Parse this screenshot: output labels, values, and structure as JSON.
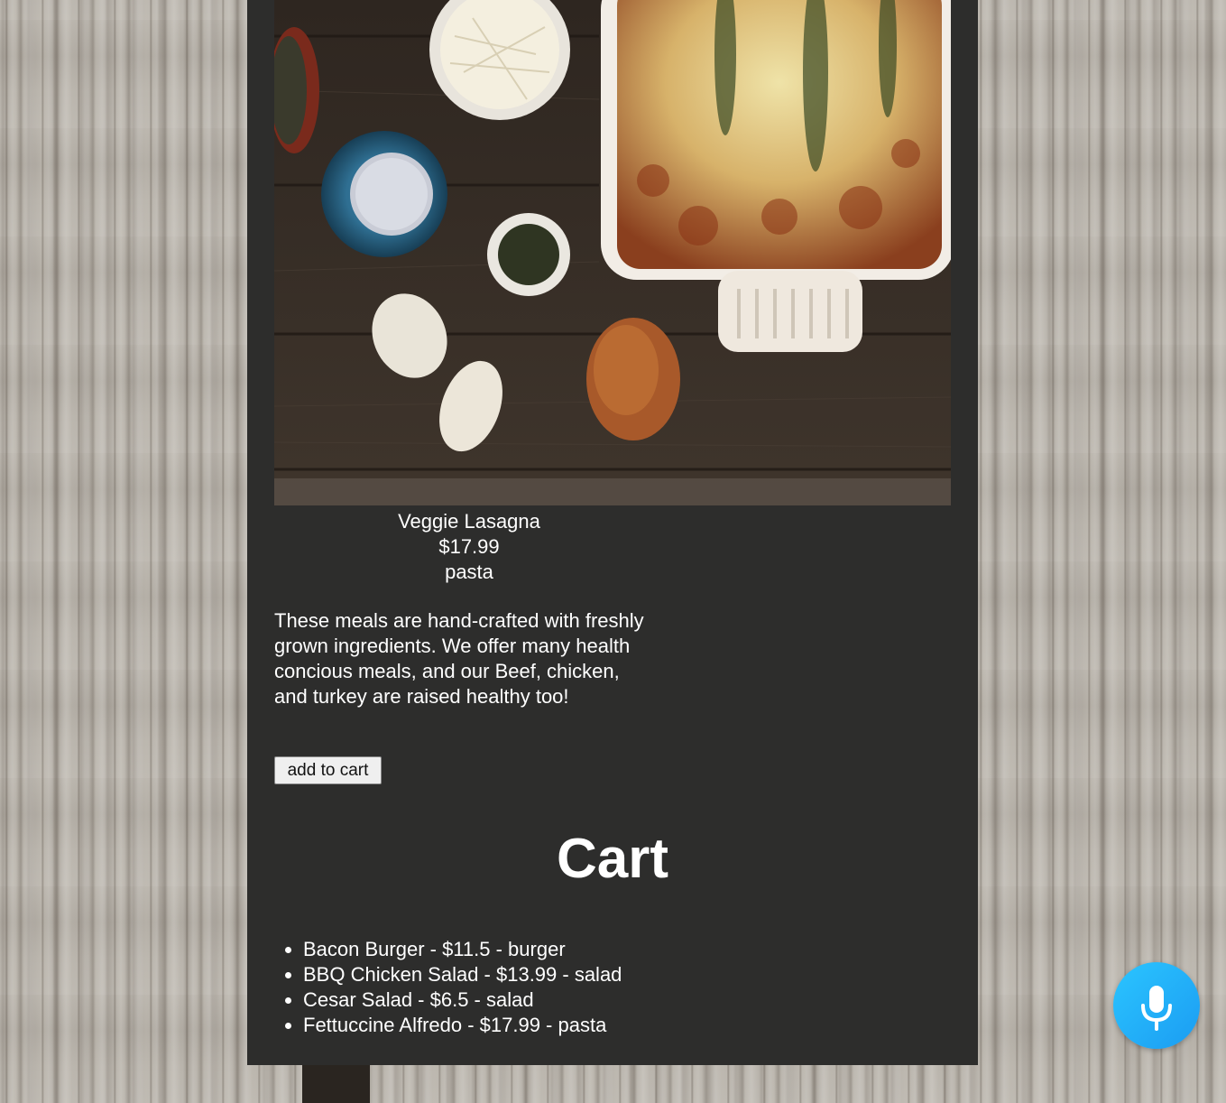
{
  "product": {
    "name": "Veggie Lasagna",
    "price": "$17.99",
    "category": "pasta",
    "description": "These meals are hand-crafted with freshly grown ingredients. We offer many health concious meals, and our Beef, chicken, and turkey are raised healthy too!",
    "add_button_label": "add to cart",
    "image_icon": "food-photo-lasagna"
  },
  "cart": {
    "title": "Cart",
    "items": [
      "Bacon Burger - $11.5 - burger",
      "BBQ Chicken Salad - $13.99 - salad",
      "Cesar Salad - $6.5 - salad",
      "Fettuccine Alfredo - $17.99 - pasta"
    ]
  },
  "voice": {
    "icon": "microphone-icon",
    "color": "#1fa6f5"
  },
  "colors": {
    "panel": "#2d2d2c",
    "text": "#ffffff"
  }
}
